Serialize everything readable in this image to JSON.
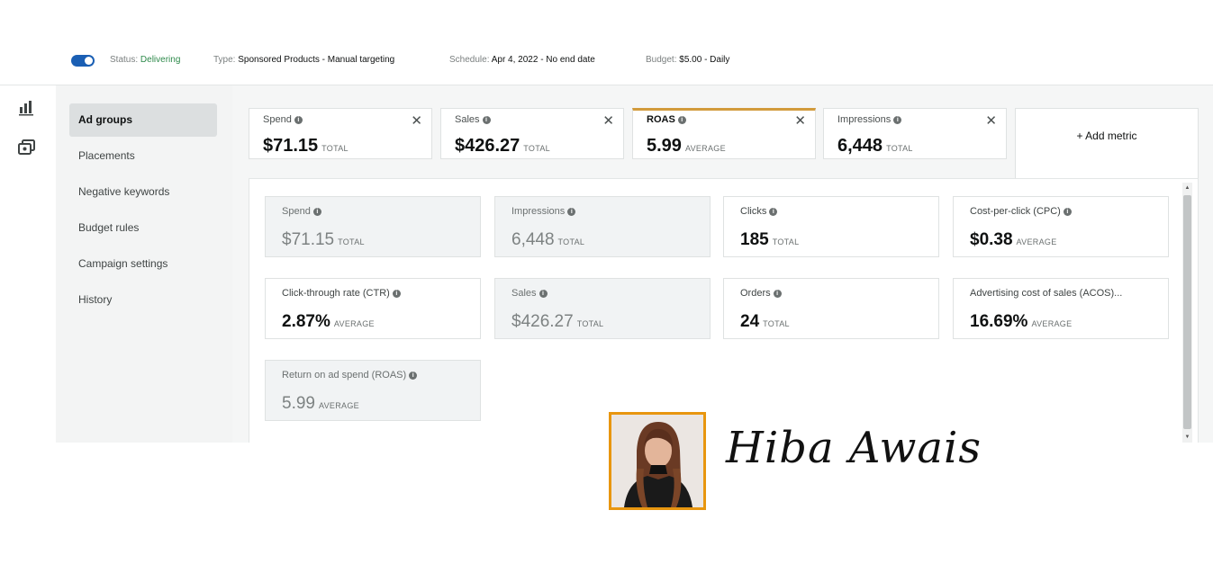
{
  "status_bar": {
    "toggle_on": true,
    "status_label": "Status:",
    "status_value": "Delivering",
    "type_label": "Type:",
    "type_value": "Sponsored Products - Manual targeting",
    "schedule_label": "Schedule:",
    "schedule_value": "Apr 4, 2022 - No end date",
    "budget_label": "Budget:",
    "budget_value": "$5.00 - Daily",
    "status_color": "#2e8a4b"
  },
  "rail": {
    "icons": [
      "bar-chart-icon",
      "campaigns-icon"
    ]
  },
  "subnav": {
    "items": [
      {
        "label": "Ad groups"
      },
      {
        "label": "Placements"
      },
      {
        "label": "Negative keywords"
      },
      {
        "label": "Budget rules"
      },
      {
        "label": "Campaign settings"
      },
      {
        "label": "History"
      }
    ],
    "active": "Ad groups"
  },
  "metric_tabs": [
    {
      "label": "Spend",
      "value": "$71.15",
      "unit": "TOTAL"
    },
    {
      "label": "Sales",
      "value": "$426.27",
      "unit": "TOTAL"
    },
    {
      "label": "ROAS",
      "value": "5.99",
      "unit": "AVERAGE"
    },
    {
      "label": "Impressions",
      "value": "6,448",
      "unit": "TOTAL"
    }
  ],
  "selected_tab": "ROAS",
  "add_metric_label": "+ Add metric",
  "cards": [
    {
      "label": "Spend",
      "value": "$71.15",
      "unit": "TOTAL"
    },
    {
      "label": "Impressions",
      "value": "6,448",
      "unit": "TOTAL"
    },
    {
      "label": "Clicks",
      "value": "185",
      "unit": "TOTAL"
    },
    {
      "label": "Cost-per-click (CPC)",
      "value": "$0.38",
      "unit": "AVERAGE"
    },
    {
      "label": "Click-through rate (CTR)",
      "value": "2.87%",
      "unit": "AVERAGE"
    },
    {
      "label": "Sales",
      "value": "$426.27",
      "unit": "TOTAL"
    },
    {
      "label": "Orders",
      "value": "24",
      "unit": "TOTAL"
    },
    {
      "label": "Advertising cost of sales (ACOS)...",
      "value": "16.69%",
      "unit": "AVERAGE"
    },
    {
      "label": "Return on ad spend (ROAS)",
      "value": "5.99",
      "unit": "AVERAGE"
    }
  ],
  "watermark": {
    "signature": "Hiba Awais",
    "frame_color": "#e8960f"
  },
  "accent_color": "#d29b3c"
}
